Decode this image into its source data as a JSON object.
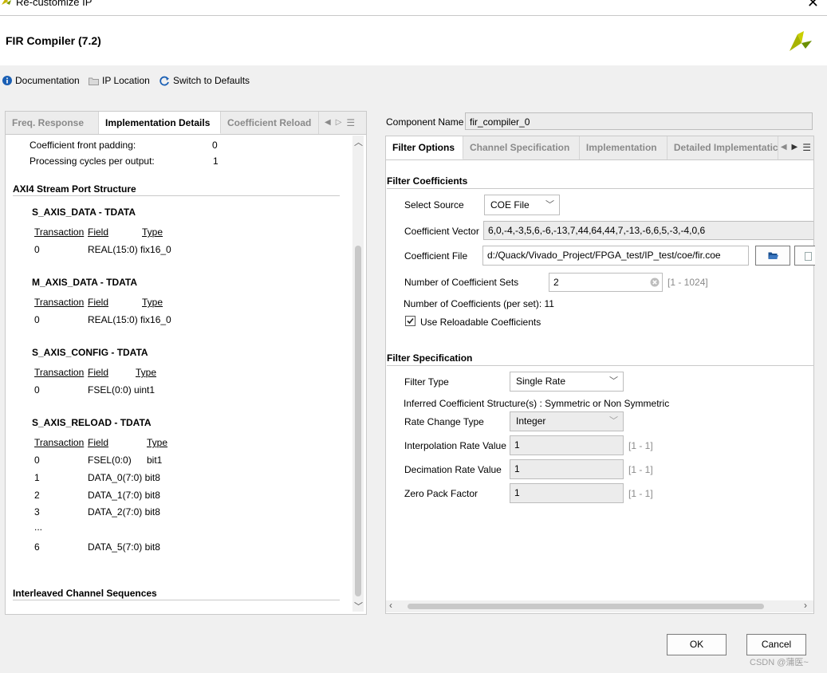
{
  "window": {
    "title": "Re-customize IP"
  },
  "header": {
    "title": "FIR Compiler (7.2)"
  },
  "toolbar": {
    "documentation": "Documentation",
    "ip_location": "IP Location",
    "switch_defaults": "Switch to Defaults"
  },
  "left": {
    "tabs": [
      "Freq. Response",
      "Implementation Details",
      "Coefficient Reload"
    ],
    "coef_front_padding_label": "Coefficient front padding:",
    "coef_front_padding_value": "0",
    "proc_cycles_label": "Processing cycles per output:",
    "proc_cycles_value": "1",
    "axi_title": "AXI4 Stream Port Structure",
    "headers": {
      "transaction": "Transaction",
      "field": "Field",
      "type": "Type"
    },
    "groups": [
      {
        "title": "S_AXIS_DATA - TDATA",
        "rows": [
          {
            "t": "0",
            "f": "REAL(15:0) fix16_0"
          }
        ]
      },
      {
        "title": "M_AXIS_DATA - TDATA",
        "rows": [
          {
            "t": "0",
            "f": "REAL(15:0) fix16_0"
          }
        ]
      },
      {
        "title": "S_AXIS_CONFIG - TDATA",
        "rows": [
          {
            "t": "0",
            "f": "FSEL(0:0) uint1"
          }
        ]
      },
      {
        "title": "S_AXIS_RELOAD - TDATA",
        "rows": [
          {
            "t": "0",
            "f": "FSEL(0:0)",
            "ty": "bit1"
          },
          {
            "t": "1",
            "f": "DATA_0(7:0) bit8"
          },
          {
            "t": "2",
            "f": "DATA_1(7:0) bit8"
          },
          {
            "t": "3",
            "f": "DATA_2(7:0) bit8"
          },
          {
            "t": "...",
            "f": ""
          },
          {
            "t": "6",
            "f": "DATA_5(7:0) bit8"
          }
        ]
      }
    ],
    "interleaved_title": "Interleaved Channel Sequences"
  },
  "right": {
    "component_name_label": "Component Name",
    "component_name_value": "fir_compiler_0",
    "tabs": [
      "Filter Options",
      "Channel Specification",
      "Implementation",
      "Detailed Implementatic"
    ],
    "filter_coefficients_title": "Filter Coefficients",
    "select_source_label": "Select Source",
    "select_source_value": "COE File",
    "coef_vector_label": "Coefficient Vector",
    "coef_vector_value": "6,0,-4,-3,5,6,-6,-13,7,44,64,44,7,-13,-6,6,5,-3,-4,0,6",
    "coef_file_label": "Coefficient File",
    "coef_file_value": "d:/Quack/Vivado_Project/FPGA_test/IP_test/coe/fir.coe",
    "num_coef_sets_label": "Number of Coefficient Sets",
    "num_coef_sets_value": "2",
    "num_coef_sets_range": "[1 - 1024]",
    "num_coefs_label": "Number of Coefficients (per set): 11",
    "use_reload_label": "Use Reloadable Coefficients",
    "use_reload_checked": true,
    "filter_spec_title": "Filter Specification",
    "filter_type_label": "Filter Type",
    "filter_type_value": "Single Rate",
    "inferred_label": "Inferred Coefficient Structure(s) : Symmetric or Non Symmetric",
    "rate_change_label": "Rate Change Type",
    "rate_change_value": "Integer",
    "interp_label": "Interpolation Rate Value",
    "interp_value": "1",
    "interp_range": "[1 - 1]",
    "decim_label": "Decimation Rate Value",
    "decim_value": "1",
    "decim_range": "[1 - 1]",
    "zero_pack_label": "Zero Pack Factor",
    "zero_pack_value": "1",
    "zero_pack_range": "[1 - 1]"
  },
  "footer": {
    "ok": "OK",
    "cancel": "Cancel",
    "watermark": "CSDN @蒲医~"
  }
}
